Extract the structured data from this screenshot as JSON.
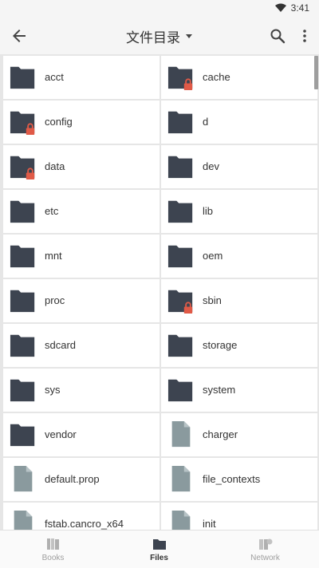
{
  "status": {
    "time": "3:41"
  },
  "toolbar": {
    "title": "文件目录"
  },
  "icons": {
    "folder": "folder-icon",
    "locked_folder": "locked-folder-icon",
    "file": "file-icon"
  },
  "files": [
    {
      "name": "acct",
      "type": "folder"
    },
    {
      "name": "cache",
      "type": "locked"
    },
    {
      "name": "config",
      "type": "locked"
    },
    {
      "name": "d",
      "type": "folder"
    },
    {
      "name": "data",
      "type": "locked"
    },
    {
      "name": "dev",
      "type": "folder"
    },
    {
      "name": "etc",
      "type": "folder"
    },
    {
      "name": "lib",
      "type": "folder"
    },
    {
      "name": "mnt",
      "type": "folder"
    },
    {
      "name": "oem",
      "type": "folder"
    },
    {
      "name": "proc",
      "type": "folder"
    },
    {
      "name": "sbin",
      "type": "locked"
    },
    {
      "name": "sdcard",
      "type": "folder"
    },
    {
      "name": "storage",
      "type": "folder"
    },
    {
      "name": "sys",
      "type": "folder"
    },
    {
      "name": "system",
      "type": "folder"
    },
    {
      "name": "vendor",
      "type": "folder"
    },
    {
      "name": "charger",
      "type": "file"
    },
    {
      "name": "default.prop",
      "type": "file"
    },
    {
      "name": "file_contexts",
      "type": "file"
    },
    {
      "name": "fstab.cancro_x64",
      "type": "file"
    },
    {
      "name": "init",
      "type": "file"
    }
  ],
  "bottom_nav": [
    {
      "label": "Books",
      "icon": "books-icon",
      "active": false
    },
    {
      "label": "Files",
      "icon": "folder-icon",
      "active": true
    },
    {
      "label": "Network",
      "icon": "network-icon",
      "active": false
    }
  ],
  "colors": {
    "folder": "#3d4450",
    "lock": "#e05a47",
    "file": "#8a9a9e"
  }
}
